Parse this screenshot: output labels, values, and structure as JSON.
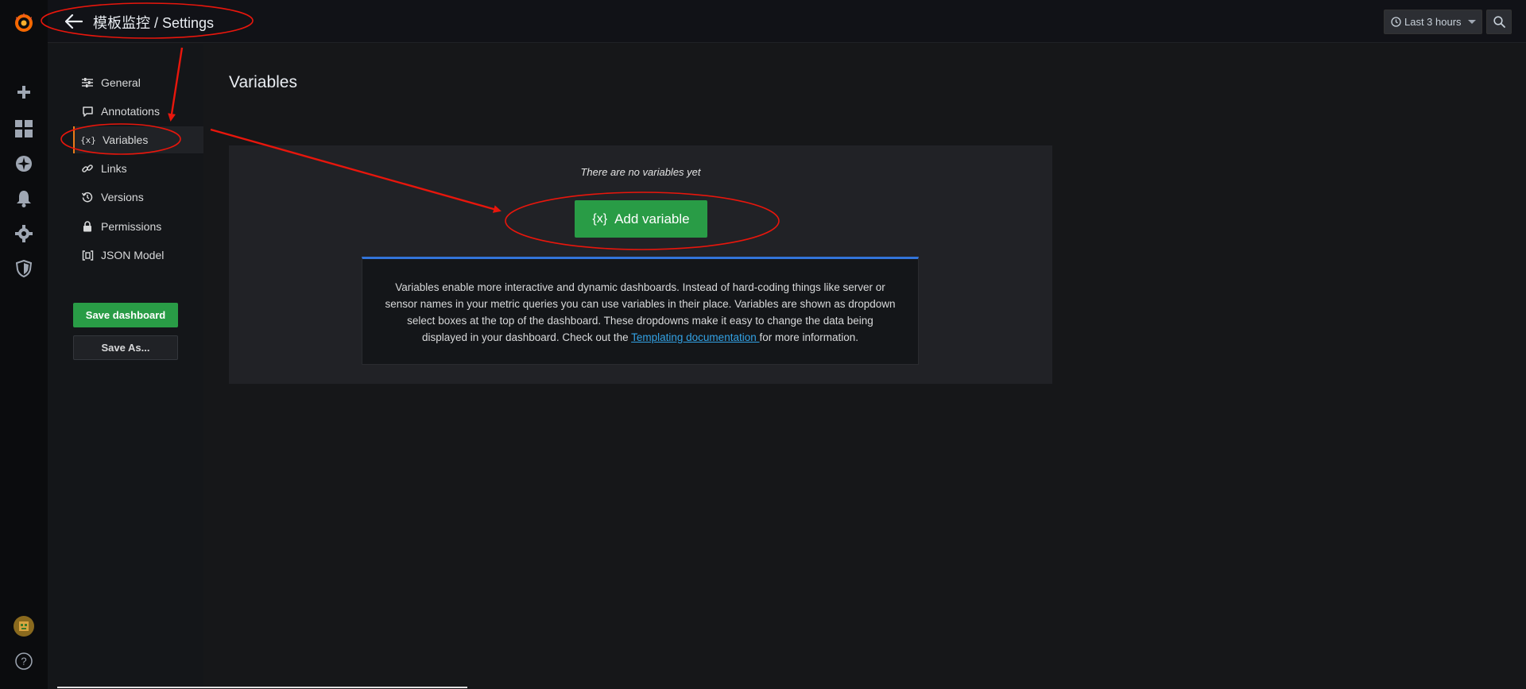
{
  "topbar": {
    "breadcrumb": "模板监控 / Settings",
    "time_range": "Last 3 hours"
  },
  "rail": {
    "items": [
      {
        "name": "grafana-logo-icon"
      },
      {
        "name": "plus-icon"
      },
      {
        "name": "dashboards-icon"
      },
      {
        "name": "explore-compass-icon"
      },
      {
        "name": "alerting-bell-icon"
      },
      {
        "name": "configuration-gear-icon"
      },
      {
        "name": "server-admin-shield-icon"
      },
      {
        "name": "user-avatar-icon"
      },
      {
        "name": "help-icon"
      }
    ]
  },
  "settings_nav": {
    "items": [
      {
        "label": "General",
        "icon": "sliders-icon"
      },
      {
        "label": "Annotations",
        "icon": "comment-icon"
      },
      {
        "label": "Variables",
        "icon": "variable-braces-icon",
        "active": true
      },
      {
        "label": "Links",
        "icon": "link-icon"
      },
      {
        "label": "Versions",
        "icon": "history-icon"
      },
      {
        "label": "Permissions",
        "icon": "lock-icon"
      },
      {
        "label": "JSON Model",
        "icon": "json-brackets-icon"
      }
    ],
    "save_dashboard": "Save dashboard",
    "save_as": "Save As..."
  },
  "main": {
    "title": "Variables",
    "empty_text": "There are no variables yet",
    "add_variable_icon": "{x}",
    "add_variable_label": "Add variable",
    "info_part1": "Variables enable more interactive and dynamic dashboards. Instead of hard-coding things like server or sensor names in your metric queries you can use variables in their place. Variables are shown as dropdown select boxes at the top of the dashboard. These dropdowns make it easy to change the data being displayed in your dashboard. Check out the ",
    "info_link": "Templating documentation ",
    "info_part2": "for more information."
  },
  "colors": {
    "accent_green": "#299c46",
    "active_border": "#eb7b18",
    "info_border": "#3274d9",
    "annotation_red": "#e8160c"
  }
}
